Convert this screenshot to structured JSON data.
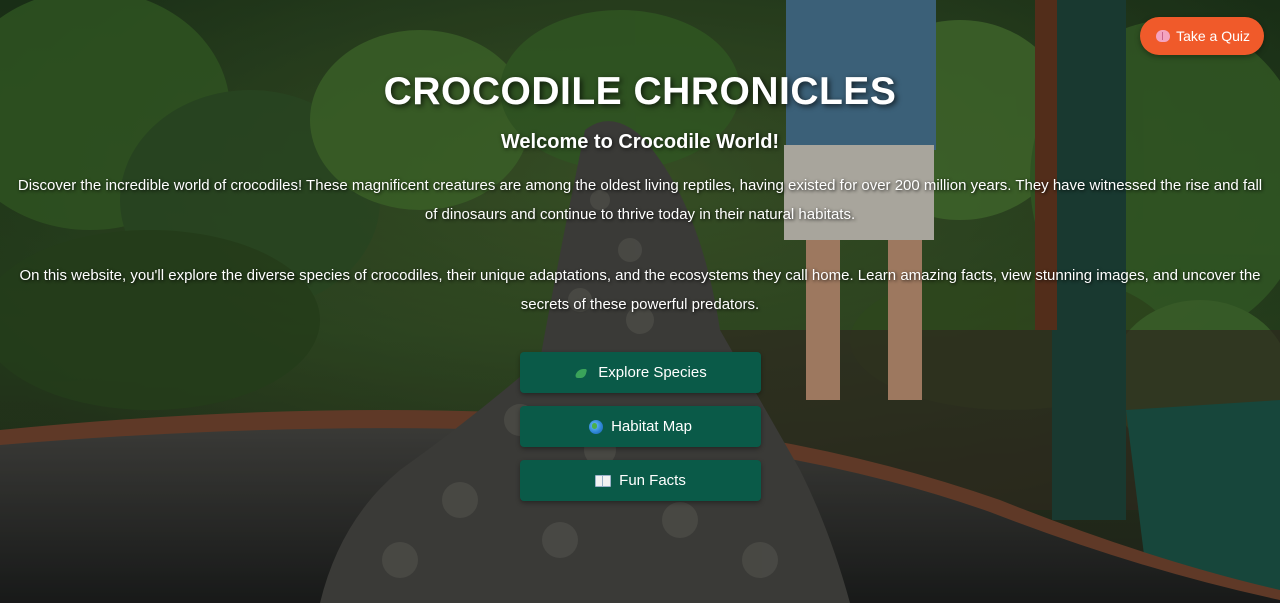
{
  "header": {
    "quiz_button": {
      "label": "Take a Quiz",
      "icon": "brain-icon",
      "color": "#f05a2a"
    }
  },
  "hero": {
    "title": "CROCODILE CHRONICLES",
    "subtitle": "Welcome to Crocodile World!",
    "paragraph_1": "Discover the incredible world of crocodiles! These magnificent creatures are among the oldest living reptiles, having existed for over 200 million years. They have witnessed the rise and fall of dinosaurs and continue to thrive today in their natural habitats.",
    "paragraph_2": "On this website, you'll explore the diverse species of crocodiles, their unique adaptations, and the ecosystems they call home. Learn amazing facts, view stunning images, and uncover the secrets of these powerful predators."
  },
  "nav_buttons": [
    {
      "label": "Explore Species",
      "icon": "crocodile-icon"
    },
    {
      "label": "Habitat Map",
      "icon": "globe-icon"
    },
    {
      "label": "Fun Facts",
      "icon": "book-icon"
    }
  ],
  "colors": {
    "button_bg": "#0a5a48",
    "quiz_bg": "#f05a2a",
    "text": "#ffffff"
  }
}
